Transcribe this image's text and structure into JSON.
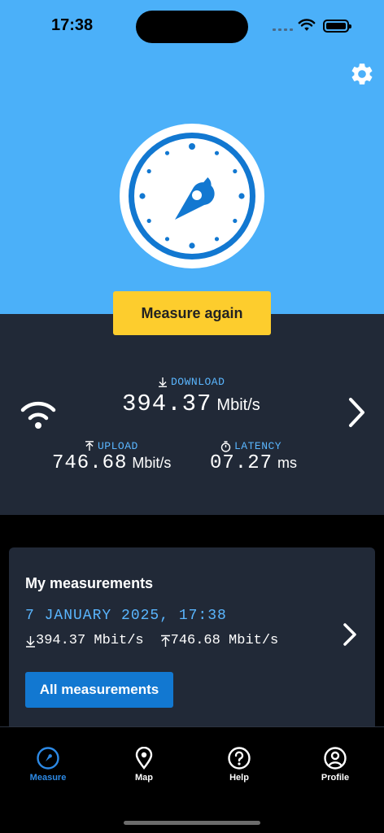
{
  "status_bar": {
    "time": "17:38"
  },
  "measure": {
    "button_label": "Measure again"
  },
  "results": {
    "download": {
      "label": "DOWNLOAD",
      "value": "394.37",
      "unit": "Mbit/s"
    },
    "upload": {
      "label": "UPLOAD",
      "value": "746.68",
      "unit": "Mbit/s"
    },
    "latency": {
      "label": "LATENCY",
      "value": "07.27",
      "unit": "ms"
    },
    "connection_icon": "wifi-icon"
  },
  "my_measurements": {
    "title": "My measurements",
    "entry": {
      "date": "7 JANUARY 2025, 17:38",
      "download": "394.37 Mbit/s",
      "upload": "746.68 Mbit/s"
    },
    "all_button_label": "All measurements"
  },
  "tabs": [
    {
      "label": "Measure",
      "icon": "gauge-icon",
      "active": true
    },
    {
      "label": "Map",
      "icon": "map-pin-icon",
      "active": false
    },
    {
      "label": "Help",
      "icon": "help-icon",
      "active": false
    },
    {
      "label": "Profile",
      "icon": "profile-icon",
      "active": false
    }
  ],
  "colors": {
    "sky": "#4bb0f9",
    "panel": "#212937",
    "accent_yellow": "#fdcd2d",
    "accent_blue": "#1278d1",
    "label_blue": "#5ab6ff"
  }
}
